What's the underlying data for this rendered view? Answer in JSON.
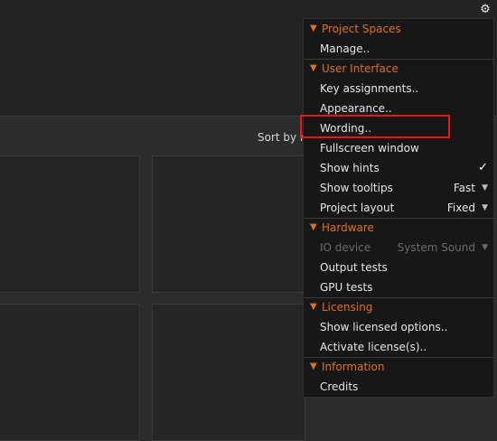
{
  "header": {
    "sort_label": "Sort by n"
  },
  "menu": {
    "project_spaces": {
      "title": "Project Spaces",
      "manage": "Manage.."
    },
    "user_interface": {
      "title": "User Interface",
      "key_assignments": "Key assignments..",
      "appearance": "Appearance..",
      "wording": "Wording..",
      "fullscreen": "Fullscreen window",
      "show_hints": "Show hints",
      "show_hints_check": "✓",
      "show_tooltips": "Show tooltips",
      "show_tooltips_value": "Fast",
      "project_layout": "Project layout",
      "project_layout_value": "Fixed"
    },
    "hardware": {
      "title": "Hardware",
      "io_device": "IO device",
      "io_device_value": "System Sound",
      "output_tests": "Output tests",
      "gpu_tests": "GPU tests"
    },
    "licensing": {
      "title": "Licensing",
      "show_licensed": "Show licensed options..",
      "activate": "Activate license(s).."
    },
    "information": {
      "title": "Information",
      "credits": "Credits"
    }
  },
  "colors": {
    "section": "#e06f1f",
    "highlight": "#e21919",
    "menu_bg": "#171717"
  },
  "icons": {
    "gear": "gear-icon",
    "section": "triangle-down-icon",
    "dropdown": "dropdown-arrow-icon"
  }
}
